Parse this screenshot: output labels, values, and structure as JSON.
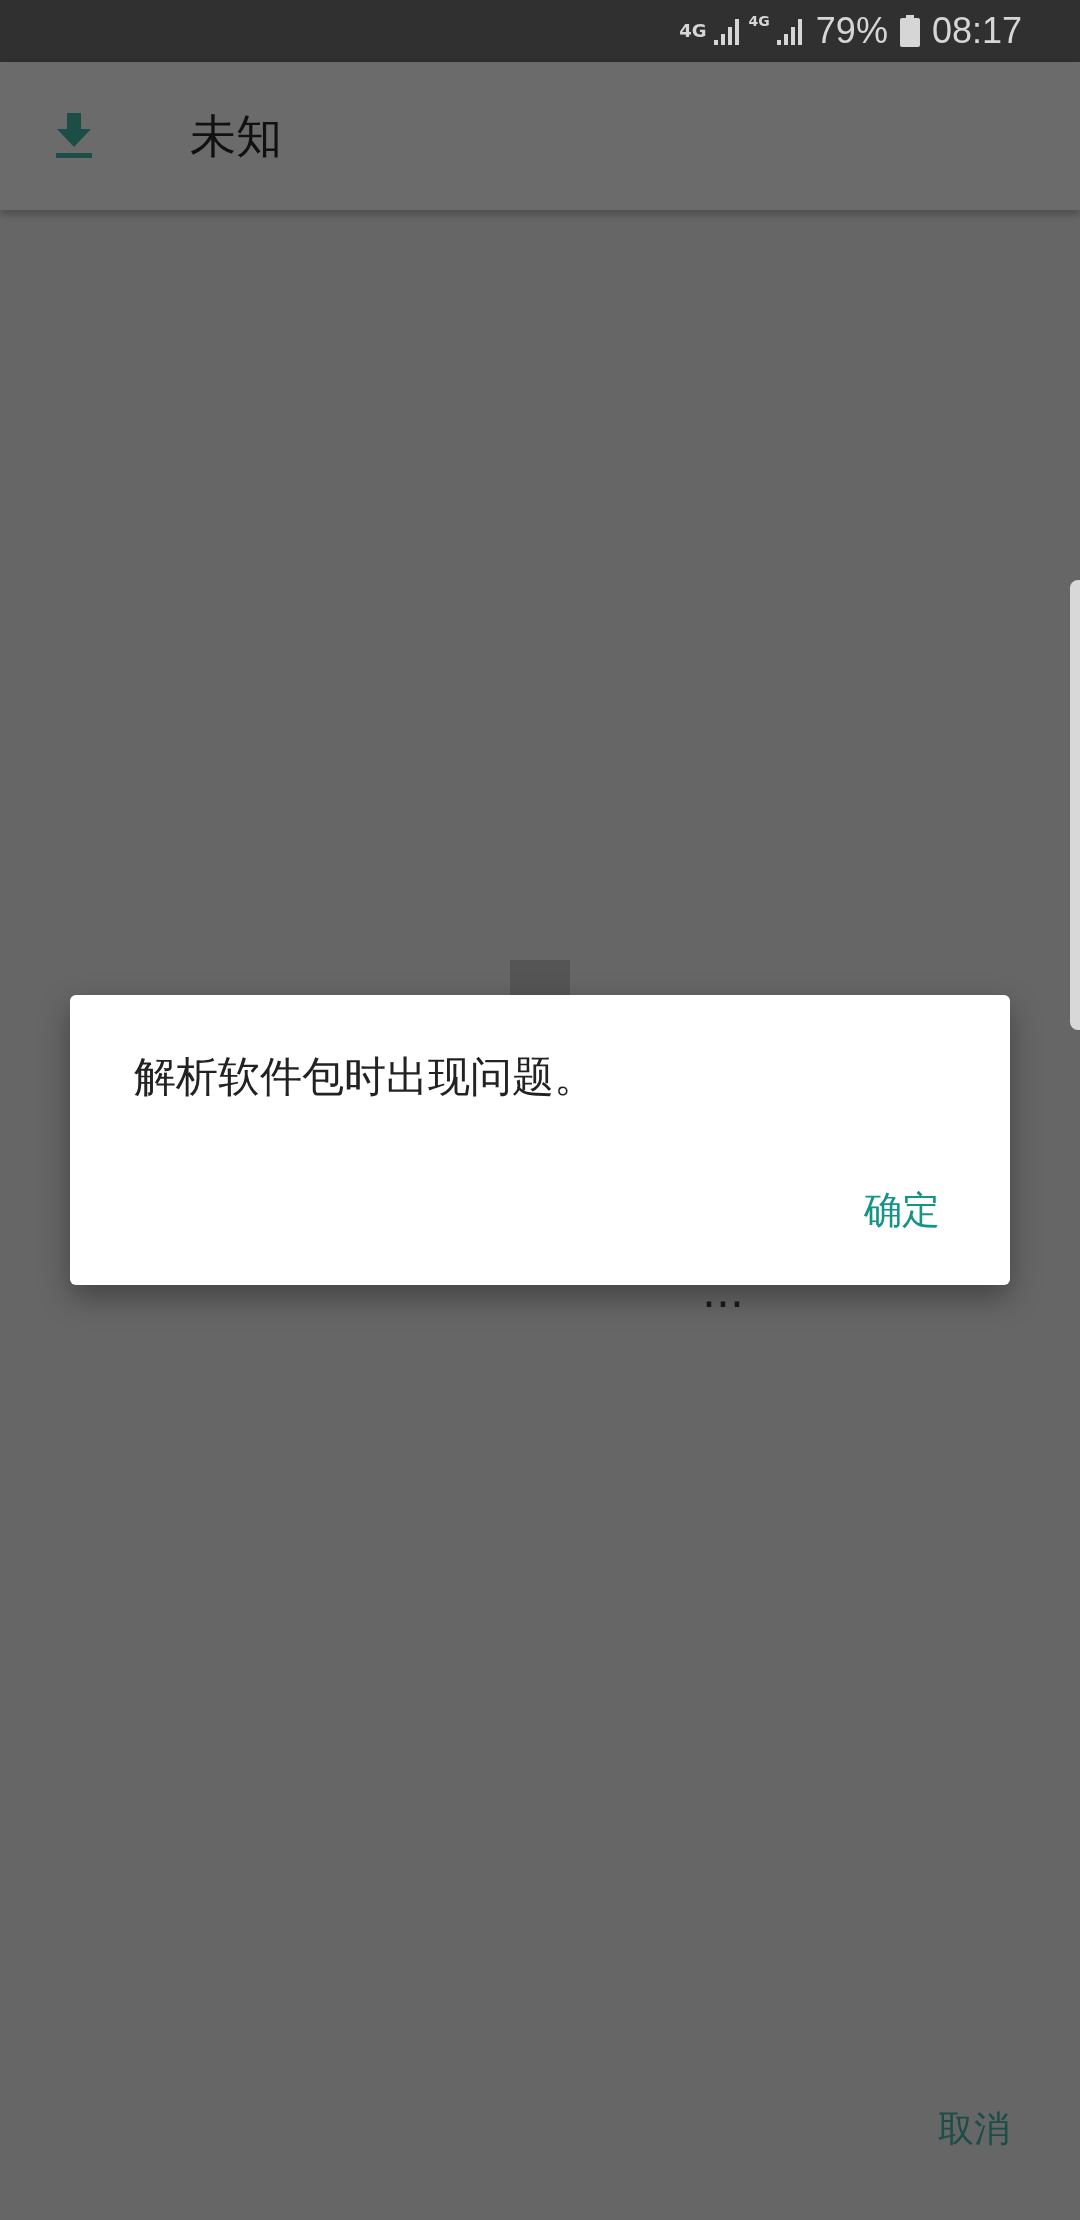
{
  "status_bar": {
    "network_1": "4G",
    "network_2": "4G",
    "battery": "79%",
    "time": "08:17"
  },
  "app_bar": {
    "title": "未知"
  },
  "background": {
    "status_text": "...",
    "cancel_button": "取消"
  },
  "dialog": {
    "message": "解析软件包时出现问题。",
    "buttons": [
      "确定"
    ]
  }
}
